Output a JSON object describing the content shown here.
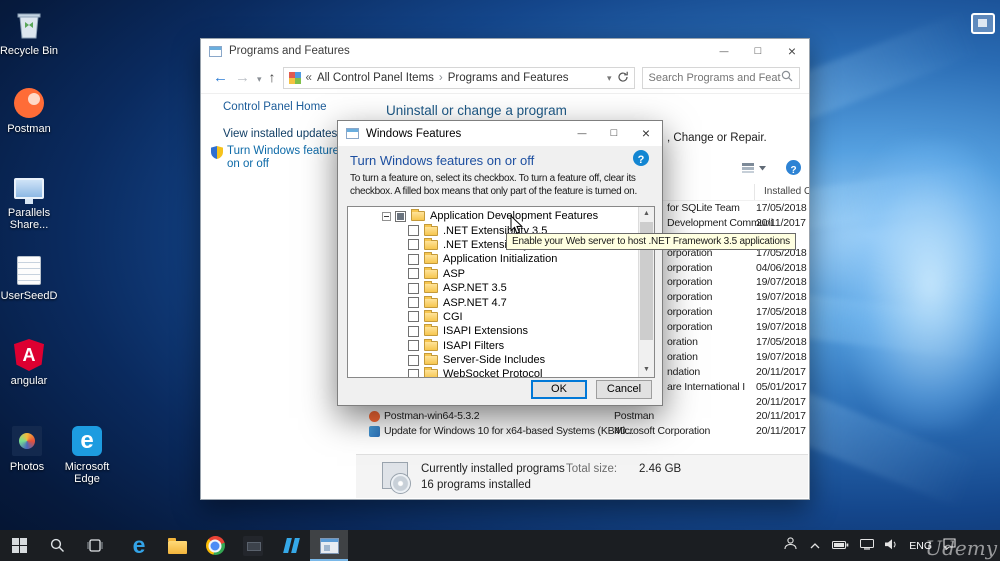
{
  "desktop": {
    "icons": [
      {
        "label": "Recycle Bin"
      },
      {
        "label": "Postman"
      },
      {
        "label": "Parallels Share..."
      },
      {
        "label": "UserSeedD"
      },
      {
        "label": "angular"
      },
      {
        "label": "Photos"
      },
      {
        "label": "Microsoft Edge"
      }
    ]
  },
  "explorer": {
    "title": "Programs and Features",
    "nav": {
      "back_prefix": "«",
      "crumb1": "All Control Panel Items",
      "sep": "›",
      "crumb2": "Programs and Features",
      "search_placeholder": "Search Programs and Features"
    },
    "sidebar": {
      "home": "Control Panel Home",
      "view_updates": "View installed updates",
      "turn_features": "Turn Windows features on or off"
    },
    "main": {
      "heading": "Uninstall or change a program",
      "subtext_fragment": ", Change or Repair.",
      "installed_on_header": "Installed On"
    },
    "rows": [
      {
        "name": "",
        "publisher": "for SQLite Team",
        "date": "17/05/2018"
      },
      {
        "name": "",
        "publisher": "Development Communi",
        "date": "20/11/2017"
      },
      {
        "name": "",
        "publisher": "",
        "date": ""
      },
      {
        "name": "",
        "publisher": "orporation",
        "date": "17/05/2018"
      },
      {
        "name": "",
        "publisher": "orporation",
        "date": "04/06/2018"
      },
      {
        "name": "",
        "publisher": "orporation",
        "date": "19/07/2018"
      },
      {
        "name": "",
        "publisher": "orporation",
        "date": "19/07/2018"
      },
      {
        "name": "",
        "publisher": "orporation",
        "date": "17/05/2018"
      },
      {
        "name": "",
        "publisher": "orporation",
        "date": "19/07/2018"
      },
      {
        "name": "",
        "publisher": "oration",
        "date": "17/05/2018"
      },
      {
        "name": "",
        "publisher": "oration",
        "date": "19/07/2018"
      },
      {
        "name": "",
        "publisher": "ndation",
        "date": "20/11/2017"
      },
      {
        "name": "",
        "publisher": "are International I",
        "date": "05/01/2017"
      },
      {
        "name": "",
        "publisher": "",
        "date": "20/11/2017"
      },
      {
        "name": "Postman-win64-5.3.2",
        "publisher": "Postman",
        "date": "20/11/2017"
      },
      {
        "name": "Update for Windows 10 for x64-based Systems (KB40...",
        "publisher": "Microsoft Corporation",
        "date": "20/11/2017"
      }
    ],
    "footer": {
      "title": "Currently installed programs",
      "size_label": "Total size:",
      "size_value": "2.46 GB",
      "count": "16 programs installed"
    }
  },
  "features_dialog": {
    "title": "Windows Features",
    "heading": "Turn Windows features on or off",
    "desc_line1": "To turn a feature on, select its checkbox. To turn a feature off, clear its",
    "desc_line2": "checkbox. A filled box means that only part of the feature is turned on.",
    "tree": [
      {
        "label": "Application Development Features",
        "state": "partial",
        "expanded": true
      },
      {
        "label": ".NET Extensibility 3.5",
        "state": "unchecked"
      },
      {
        "label": ".NET Extensibility",
        "state": "unchecked"
      },
      {
        "label": "Application Initialization",
        "state": "unchecked"
      },
      {
        "label": "ASP",
        "state": "unchecked"
      },
      {
        "label": "ASP.NET 3.5",
        "state": "unchecked"
      },
      {
        "label": "ASP.NET 4.7",
        "state": "unchecked"
      },
      {
        "label": "CGI",
        "state": "unchecked"
      },
      {
        "label": "ISAPI Extensions",
        "state": "unchecked"
      },
      {
        "label": "ISAPI Filters",
        "state": "unchecked"
      },
      {
        "label": "Server-Side Includes",
        "state": "unchecked"
      },
      {
        "label": "WebSocket Protocol",
        "state": "unchecked"
      }
    ],
    "tooltip": "Enable your Web server to host .NET Framework 3.5 applications",
    "ok_label": "OK",
    "cancel_label": "Cancel"
  },
  "taskbar": {
    "language": "ENG",
    "watermark": "Udemy",
    "app_icons": [
      "start",
      "search",
      "task-view",
      "edge",
      "file-explorer",
      "chrome",
      "dark-app",
      "blue-app",
      "programs-and-features"
    ],
    "tray_icons": [
      "people",
      "hidden-icons-chevron",
      "battery",
      "display",
      "volume",
      "language",
      "action-center"
    ],
    "active_app": "programs-and-features"
  }
}
